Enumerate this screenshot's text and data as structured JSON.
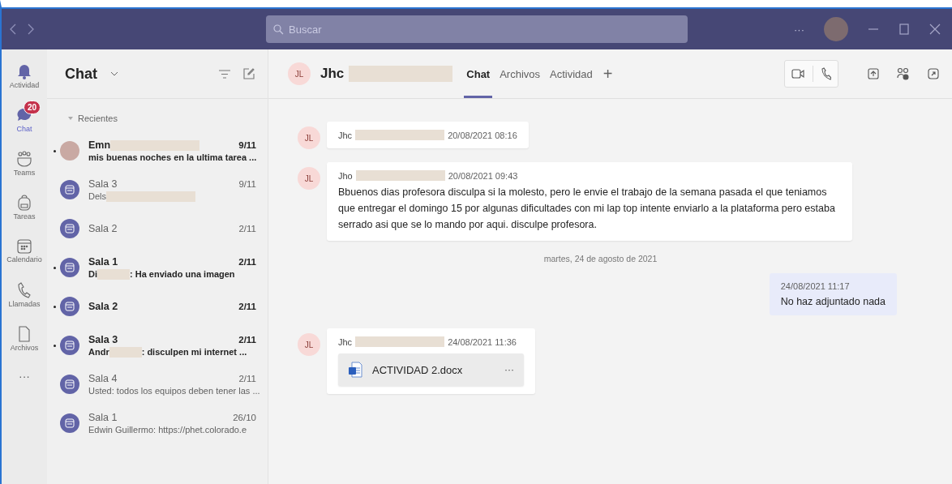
{
  "title_bar": {
    "search": {
      "placeholder": "Buscar"
    },
    "more": "···"
  },
  "rail": [
    {
      "label": "Actividad",
      "selected": false
    },
    {
      "label": "Chat",
      "selected": true,
      "badge": "20"
    },
    {
      "label": "Teams",
      "selected": false
    },
    {
      "label": "Tareas",
      "selected": false
    },
    {
      "label": "Calendario",
      "selected": false
    },
    {
      "label": "Llamadas",
      "selected": false
    },
    {
      "label": "Archivos",
      "selected": false
    }
  ],
  "rail_more": "···",
  "chat_list": {
    "title": "Chat",
    "section": "Recientes",
    "items": [
      {
        "kind": "photo",
        "name": "Emn",
        "name_redacted": true,
        "date": "9/11",
        "preview": "mis buenas noches en la ultima tarea ...",
        "unread": true
      },
      {
        "kind": "room",
        "name": "Sala 3",
        "date": "9/11",
        "preview": "Dels",
        "preview_redacted": true,
        "unread": false
      },
      {
        "kind": "room",
        "name": "Sala 2",
        "date": "2/11",
        "unread": false
      },
      {
        "kind": "room",
        "name": "Sala 1",
        "date": "2/11",
        "preview": "Di",
        "preview_redacted": true,
        "preview_rest": ": Ha enviado una imagen",
        "unread": true
      },
      {
        "kind": "room",
        "name": "Sala 2",
        "date": "2/11",
        "unread": true
      },
      {
        "kind": "room",
        "name": "Sala 3",
        "date": "2/11",
        "preview": "Andr",
        "preview_redacted": true,
        "preview_rest": ": disculpen mi internet ...",
        "unread": true
      },
      {
        "kind": "room",
        "name": "Sala 4",
        "date": "2/11",
        "preview": "Usted: todos los equipos deben tener las ...",
        "unread": false
      },
      {
        "kind": "room",
        "name": "Sala 1",
        "date": "26/10",
        "preview": "Edwin Guillermo: https://phet.colorado.e",
        "unread": false
      }
    ]
  },
  "conversation": {
    "initials": "JL",
    "name": "Jhc",
    "name_redacted": true,
    "tabs": [
      {
        "label": "Chat",
        "selected": true
      },
      {
        "label": "Archivos",
        "selected": false
      },
      {
        "label": "Actividad",
        "selected": false
      }
    ],
    "add_tab": "+",
    "messages": [
      {
        "kind": "received",
        "initials": "JL",
        "author": "Jhc",
        "author_redacted": true,
        "time": "20/08/2021 08:16"
      },
      {
        "kind": "received",
        "initials": "JL",
        "author": "Jho",
        "author_redacted": true,
        "time": "20/08/2021 09:43",
        "text": "Bbuenos dias profesora disculpa si la molesto, pero le envie el trabajo de la semana pasada el que teniamos que entregar el domingo 15 por algunas dificultades con mi lap top intente enviarlo a la plataforma pero estaba serrado asi que se lo mando por aqui. disculpe profesora."
      },
      {
        "kind": "divider",
        "text": "martes, 24 de agosto de 2021"
      },
      {
        "kind": "sent",
        "time": "24/08/2021 11:17",
        "text": "No haz adjuntado nada"
      },
      {
        "kind": "received",
        "initials": "JL",
        "author": "Jhc",
        "author_redacted": true,
        "time": "24/08/2021 11:36",
        "file": {
          "name": "ACTIVIDAD 2.docx",
          "more": "···"
        }
      }
    ]
  }
}
